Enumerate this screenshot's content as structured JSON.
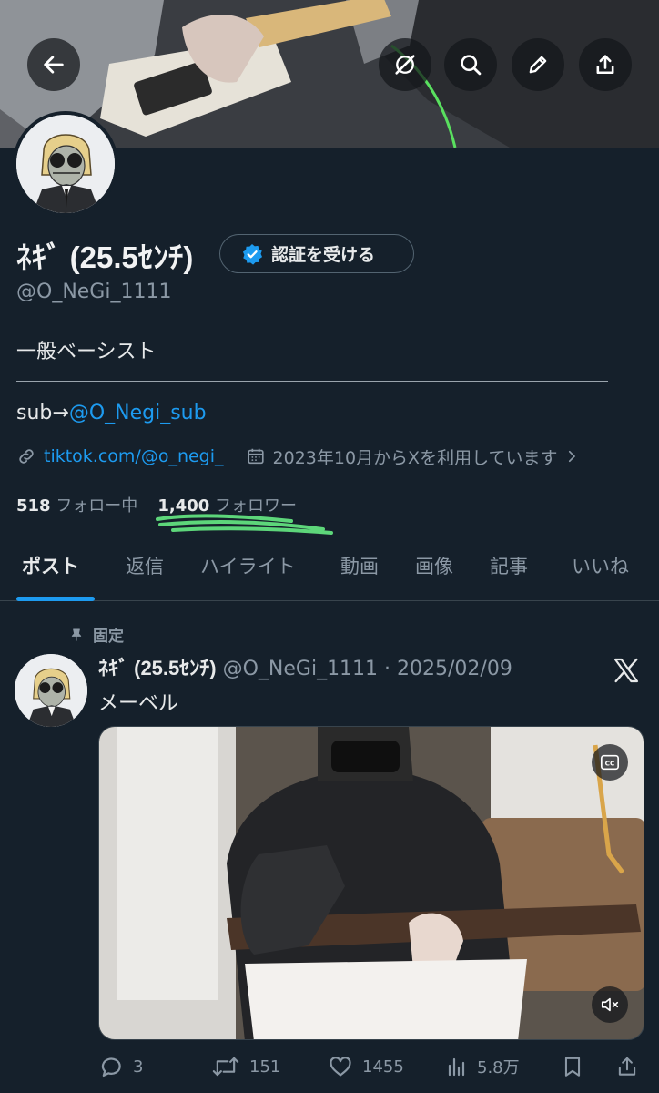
{
  "profile": {
    "display_name": "ﾈｷﾞ (25.5ｾﾝﾁ)",
    "verify_label": "認証を受ける",
    "handle": "@O_NeGi_1111",
    "bio_line1": "一般ベーシスト",
    "bio_sub_prefix": "sub→",
    "bio_sub_mention": "@O_Negi_sub",
    "link": "tiktok.com/@o_negi_",
    "joined": "2023年10月からXを利用しています",
    "following_count": "518",
    "following_label": "フォロー中",
    "followers_count": "1,400",
    "followers_label": "フォロワー"
  },
  "tabs": [
    {
      "label": "ポスト"
    },
    {
      "label": "返信"
    },
    {
      "label": "ハイライト"
    },
    {
      "label": "動画"
    },
    {
      "label": "画像"
    },
    {
      "label": "記事"
    },
    {
      "label": "いいね"
    }
  ],
  "post": {
    "pinned_label": "固定",
    "author_name": "ﾈｷﾞ (25.5ｾﾝﾁ)",
    "author_meta": "@O_NeGi_1111 · 2025/02/09",
    "text": "メーベル",
    "replies": "3",
    "reposts": "151",
    "likes": "1455",
    "views": "5.8万"
  },
  "icons": {
    "back": "back-arrow-icon",
    "grok": "grok-icon",
    "search": "search-icon",
    "edit": "pencil-icon",
    "share": "share-icon",
    "verified": "verified-badge-icon",
    "link": "link-icon",
    "calendar": "calendar-icon",
    "pin": "pin-icon",
    "x_logo": "x-logo-icon",
    "captions": "cc-icon",
    "mute": "mute-icon",
    "reply": "reply-icon",
    "repost": "repost-icon",
    "like": "heart-icon",
    "views": "views-icon",
    "bookmark": "bookmark-icon"
  },
  "colors": {
    "background": "#15202b",
    "accent": "#1d9bf0",
    "secondary_text": "#8b98a5",
    "highlight_marker": "#5dd67a"
  }
}
